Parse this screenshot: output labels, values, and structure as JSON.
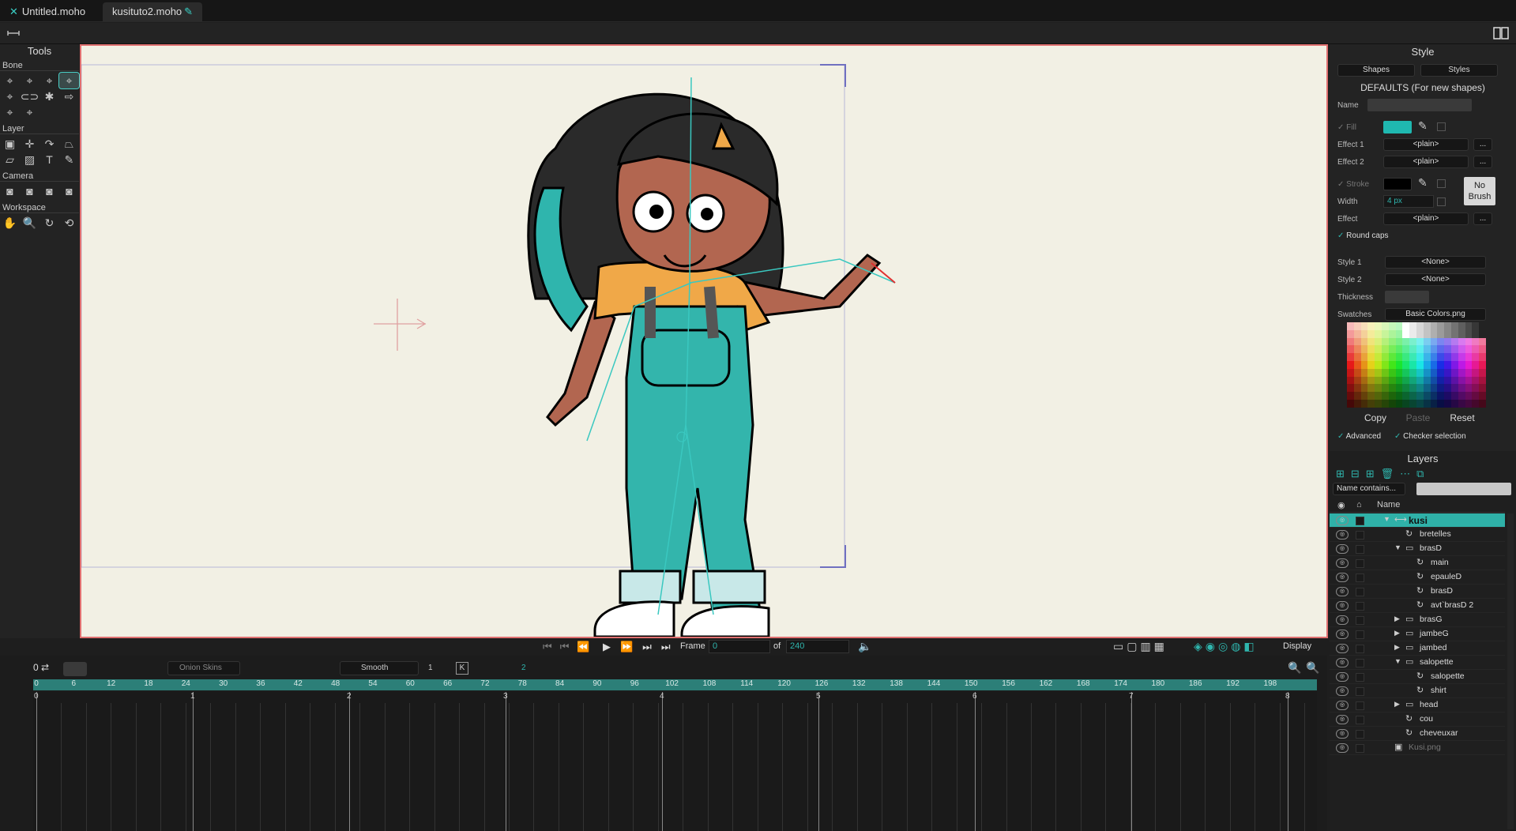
{
  "tabs": [
    {
      "label": "Untitled.moho",
      "close": "✕"
    },
    {
      "label": "kusituto2.moho",
      "mark": "✎"
    }
  ],
  "tools": {
    "title": "Tools",
    "sections": [
      {
        "label": "Bone",
        "icons": [
          "⌖",
          "⌖",
          "⌖",
          "⌖",
          "⌖",
          "⊂⊃",
          "✱",
          "⇨",
          "⌖",
          "⌖"
        ]
      },
      {
        "label": "Layer",
        "icons": [
          "▣",
          "✛",
          "↷",
          "⏢",
          "▱",
          "▨",
          "T",
          "✎"
        ]
      },
      {
        "label": "Camera",
        "icons": [
          "◙",
          "◙",
          "◙",
          "◙"
        ]
      },
      {
        "label": "Workspace",
        "icons": [
          "✋",
          "🔍",
          "↻",
          "⟲"
        ]
      }
    ]
  },
  "style": {
    "title": "Style",
    "shapes": "Shapes",
    "styles": "Styles",
    "defaults": "DEFAULTS (For new shapes)",
    "name_label": "Name",
    "fill_label": "Fill",
    "effect1_label": "Effect 1",
    "effect1": "<plain>",
    "effect2_label": "Effect 2",
    "effect2": "<plain>",
    "stroke_label": "Stroke",
    "width_label": "Width",
    "width_value": "4 px",
    "effect_label": "Effect",
    "effect": "<plain>",
    "dots": "...",
    "no_brush": "No Brush",
    "round_caps": "Round caps",
    "style1_label": "Style 1",
    "style1": "<None>",
    "style2_label": "Style 2",
    "style2": "<None>",
    "thickness_label": "Thickness",
    "swatches_label": "Swatches",
    "swatches": "Basic Colors.png",
    "copy": "Copy",
    "paste": "Paste",
    "reset": "Reset",
    "advanced": "Advanced",
    "checker": "Checker selection",
    "fill_color": "#1fb8b0",
    "stroke_color": "#000000"
  },
  "layers": {
    "title": "Layers",
    "filter": "Name contains...",
    "name_header": "Name",
    "items": [
      {
        "name": "kusi",
        "indent": 0,
        "type": "bone",
        "sel": true
      },
      {
        "name": "bretelles",
        "indent": 1,
        "type": "vector"
      },
      {
        "name": "brasD",
        "indent": 1,
        "type": "group",
        "open": true
      },
      {
        "name": "main",
        "indent": 2,
        "type": "vector"
      },
      {
        "name": "epauleD",
        "indent": 2,
        "type": "vector"
      },
      {
        "name": "brasD",
        "indent": 2,
        "type": "vector"
      },
      {
        "name": "avt`brasD 2",
        "indent": 2,
        "type": "vector"
      },
      {
        "name": "brasG",
        "indent": 1,
        "type": "group"
      },
      {
        "name": "jambeG",
        "indent": 1,
        "type": "group"
      },
      {
        "name": "jambed",
        "indent": 1,
        "type": "group"
      },
      {
        "name": "salopette",
        "indent": 1,
        "type": "group",
        "open": true
      },
      {
        "name": "salopette",
        "indent": 2,
        "type": "vector"
      },
      {
        "name": "shirt",
        "indent": 2,
        "type": "vector"
      },
      {
        "name": "head",
        "indent": 1,
        "type": "group"
      },
      {
        "name": "cou",
        "indent": 1,
        "type": "vector"
      },
      {
        "name": "cheveuxar",
        "indent": 1,
        "type": "vector"
      },
      {
        "name": "Kusi.png",
        "indent": 0,
        "type": "image",
        "dim": true
      }
    ]
  },
  "viewbar": {
    "frame_label": "Frame",
    "frame": "0",
    "of_label": "of",
    "of": "240",
    "display": "Display"
  },
  "timeline": {
    "onion": "Onion Skins",
    "smooth": "Smooth",
    "one": "1",
    "two": "2",
    "k": "K",
    "zero": "0",
    "ruler": [
      "0",
      "6",
      "12",
      "18",
      "24",
      "30",
      "36",
      "42",
      "48",
      "54",
      "60",
      "66",
      "72",
      "78",
      "84",
      "90",
      "96",
      "102",
      "108",
      "114",
      "120",
      "126",
      "132",
      "138",
      "144",
      "150",
      "156",
      "162",
      "168",
      "174",
      "180",
      "186",
      "192",
      "198"
    ],
    "seconds": [
      "0",
      "1",
      "2",
      "3",
      "4",
      "5",
      "6",
      "7",
      "8"
    ]
  }
}
